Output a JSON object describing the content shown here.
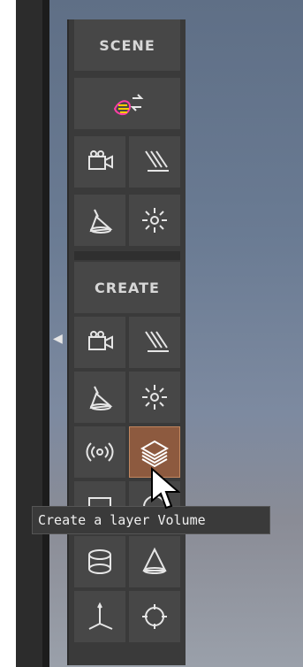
{
  "toolbar": {
    "scene_header": "SCENE",
    "create_header": "CREATE",
    "tooltip": "Create a layer Volume",
    "buttons": {
      "scene": [
        "brush-swap-icon",
        "camera-icon",
        "directional-light-icon",
        "spot-light-icon",
        "point-light-icon"
      ],
      "create": [
        "camera-icon",
        "directional-light-icon",
        "spot-light-icon",
        "point-light-icon",
        "broadcast-icon",
        "layers-icon",
        "cylinder-icon",
        "cone-icon",
        "axis-icon",
        "target-icon"
      ]
    }
  },
  "colors": {
    "panel_bg": "#3a3a3a",
    "button_bg": "#474747",
    "active_button": "#8d5a3f",
    "text": "#d7d7d7"
  }
}
